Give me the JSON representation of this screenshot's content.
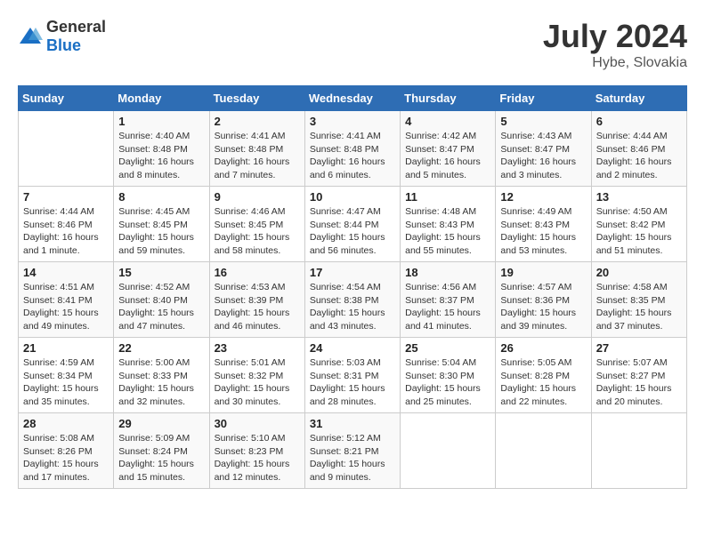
{
  "header": {
    "logo_general": "General",
    "logo_blue": "Blue",
    "month": "July 2024",
    "location": "Hybe, Slovakia"
  },
  "weekdays": [
    "Sunday",
    "Monday",
    "Tuesday",
    "Wednesday",
    "Thursday",
    "Friday",
    "Saturday"
  ],
  "weeks": [
    [
      {
        "day": "",
        "info": ""
      },
      {
        "day": "1",
        "info": "Sunrise: 4:40 AM\nSunset: 8:48 PM\nDaylight: 16 hours\nand 8 minutes."
      },
      {
        "day": "2",
        "info": "Sunrise: 4:41 AM\nSunset: 8:48 PM\nDaylight: 16 hours\nand 7 minutes."
      },
      {
        "day": "3",
        "info": "Sunrise: 4:41 AM\nSunset: 8:48 PM\nDaylight: 16 hours\nand 6 minutes."
      },
      {
        "day": "4",
        "info": "Sunrise: 4:42 AM\nSunset: 8:47 PM\nDaylight: 16 hours\nand 5 minutes."
      },
      {
        "day": "5",
        "info": "Sunrise: 4:43 AM\nSunset: 8:47 PM\nDaylight: 16 hours\nand 3 minutes."
      },
      {
        "day": "6",
        "info": "Sunrise: 4:44 AM\nSunset: 8:46 PM\nDaylight: 16 hours\nand 2 minutes."
      }
    ],
    [
      {
        "day": "7",
        "info": "Sunrise: 4:44 AM\nSunset: 8:46 PM\nDaylight: 16 hours\nand 1 minute."
      },
      {
        "day": "8",
        "info": "Sunrise: 4:45 AM\nSunset: 8:45 PM\nDaylight: 15 hours\nand 59 minutes."
      },
      {
        "day": "9",
        "info": "Sunrise: 4:46 AM\nSunset: 8:45 PM\nDaylight: 15 hours\nand 58 minutes."
      },
      {
        "day": "10",
        "info": "Sunrise: 4:47 AM\nSunset: 8:44 PM\nDaylight: 15 hours\nand 56 minutes."
      },
      {
        "day": "11",
        "info": "Sunrise: 4:48 AM\nSunset: 8:43 PM\nDaylight: 15 hours\nand 55 minutes."
      },
      {
        "day": "12",
        "info": "Sunrise: 4:49 AM\nSunset: 8:43 PM\nDaylight: 15 hours\nand 53 minutes."
      },
      {
        "day": "13",
        "info": "Sunrise: 4:50 AM\nSunset: 8:42 PM\nDaylight: 15 hours\nand 51 minutes."
      }
    ],
    [
      {
        "day": "14",
        "info": "Sunrise: 4:51 AM\nSunset: 8:41 PM\nDaylight: 15 hours\nand 49 minutes."
      },
      {
        "day": "15",
        "info": "Sunrise: 4:52 AM\nSunset: 8:40 PM\nDaylight: 15 hours\nand 47 minutes."
      },
      {
        "day": "16",
        "info": "Sunrise: 4:53 AM\nSunset: 8:39 PM\nDaylight: 15 hours\nand 46 minutes."
      },
      {
        "day": "17",
        "info": "Sunrise: 4:54 AM\nSunset: 8:38 PM\nDaylight: 15 hours\nand 43 minutes."
      },
      {
        "day": "18",
        "info": "Sunrise: 4:56 AM\nSunset: 8:37 PM\nDaylight: 15 hours\nand 41 minutes."
      },
      {
        "day": "19",
        "info": "Sunrise: 4:57 AM\nSunset: 8:36 PM\nDaylight: 15 hours\nand 39 minutes."
      },
      {
        "day": "20",
        "info": "Sunrise: 4:58 AM\nSunset: 8:35 PM\nDaylight: 15 hours\nand 37 minutes."
      }
    ],
    [
      {
        "day": "21",
        "info": "Sunrise: 4:59 AM\nSunset: 8:34 PM\nDaylight: 15 hours\nand 35 minutes."
      },
      {
        "day": "22",
        "info": "Sunrise: 5:00 AM\nSunset: 8:33 PM\nDaylight: 15 hours\nand 32 minutes."
      },
      {
        "day": "23",
        "info": "Sunrise: 5:01 AM\nSunset: 8:32 PM\nDaylight: 15 hours\nand 30 minutes."
      },
      {
        "day": "24",
        "info": "Sunrise: 5:03 AM\nSunset: 8:31 PM\nDaylight: 15 hours\nand 28 minutes."
      },
      {
        "day": "25",
        "info": "Sunrise: 5:04 AM\nSunset: 8:30 PM\nDaylight: 15 hours\nand 25 minutes."
      },
      {
        "day": "26",
        "info": "Sunrise: 5:05 AM\nSunset: 8:28 PM\nDaylight: 15 hours\nand 22 minutes."
      },
      {
        "day": "27",
        "info": "Sunrise: 5:07 AM\nSunset: 8:27 PM\nDaylight: 15 hours\nand 20 minutes."
      }
    ],
    [
      {
        "day": "28",
        "info": "Sunrise: 5:08 AM\nSunset: 8:26 PM\nDaylight: 15 hours\nand 17 minutes."
      },
      {
        "day": "29",
        "info": "Sunrise: 5:09 AM\nSunset: 8:24 PM\nDaylight: 15 hours\nand 15 minutes."
      },
      {
        "day": "30",
        "info": "Sunrise: 5:10 AM\nSunset: 8:23 PM\nDaylight: 15 hours\nand 12 minutes."
      },
      {
        "day": "31",
        "info": "Sunrise: 5:12 AM\nSunset: 8:21 PM\nDaylight: 15 hours\nand 9 minutes."
      },
      {
        "day": "",
        "info": ""
      },
      {
        "day": "",
        "info": ""
      },
      {
        "day": "",
        "info": ""
      }
    ]
  ]
}
